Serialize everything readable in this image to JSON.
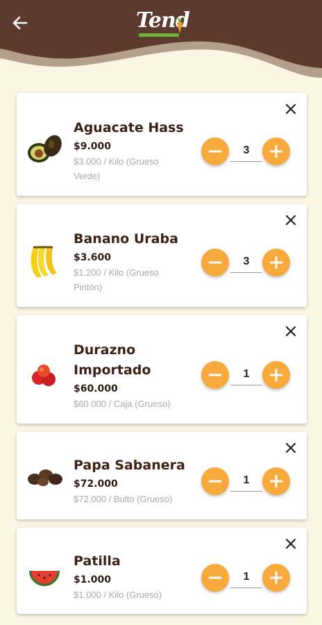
{
  "header": {
    "logo_text": "Tend",
    "colors": {
      "bg": "#5c3b2e",
      "logo_bar": "#6bb33a",
      "logo_accent": "#f29a2e"
    }
  },
  "theme": {
    "accent": "#f7a93c",
    "page_bg": "#fbf5e3"
  },
  "cart": {
    "items": [
      {
        "name": "Aguacate Hass",
        "price": "$9.000",
        "unit_line1": "$3.000 / Kilo (Grueso",
        "unit_line2": "Verde)",
        "quantity": "3",
        "image": "avocado-image"
      },
      {
        "name": "Banano Uraba",
        "price": "$3.600",
        "unit_line1": "$1.200 / Kilo (Grueso",
        "unit_line2": "Pintón)",
        "quantity": "3",
        "image": "banana-image"
      },
      {
        "name_line1": "Durazno",
        "name_line2": "Importado",
        "price": "$60.000",
        "unit_line1": "$60.000 / Caja (Grueso)",
        "quantity": "1",
        "image": "peach-image"
      },
      {
        "name": "Papa Sabanera",
        "price": "$72.000",
        "unit_line1": "$72.000 / Bulto (Grueso)",
        "quantity": "1",
        "image": "potato-image"
      },
      {
        "name": "Patilla",
        "price": "$1.000",
        "unit_line1": "$1.000 / Kilo (Grueso)",
        "quantity": "1",
        "image": "watermelon-image"
      }
    ]
  }
}
